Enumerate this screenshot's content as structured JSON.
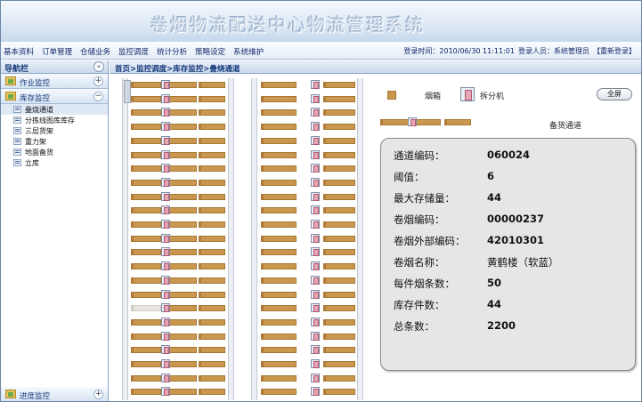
{
  "app": {
    "title": "卷烟物流配送中心物流管理系统"
  },
  "menu": [
    "基本资料",
    "订单管理",
    "仓储业务",
    "监控调度",
    "统计分析",
    "策略设定",
    "系统维护"
  ],
  "login": {
    "time_label": "登录时间：2010/06/30 11:11:01",
    "user_label": "登录人员：系统管理员",
    "relogin": "【重新登录】"
  },
  "sidebar": {
    "title": "导航栏",
    "collapse_glyph": "«",
    "groups": [
      {
        "label": "作业监控",
        "toggle": "+"
      },
      {
        "label": "库存监控",
        "toggle": "−"
      }
    ],
    "items": [
      "叠烧通道",
      "分拣线图库库存",
      "三层货架",
      "重力架",
      "地面备货",
      "立库"
    ],
    "bottom_group": {
      "label": "进度监控",
      "toggle": "+"
    }
  },
  "breadcrumb": "首页>监控调度>库存监控>叠烧通道",
  "legend": {
    "carton": "烟箱",
    "splitter": "拆分机",
    "channel": "备货通道"
  },
  "fullscreen_label": "全屏",
  "info": {
    "rows": [
      {
        "key": "通道编码：",
        "value": "060024"
      },
      {
        "key": "阈值：",
        "value": "6"
      },
      {
        "key": "最大存储量：",
        "value": "44"
      },
      {
        "key": "卷烟编码：",
        "value": "00000237"
      },
      {
        "key": "卷烟外部编码：",
        "value": "42010301"
      },
      {
        "key": "卷烟名称：",
        "value": "黄鹤楼（软蓝）"
      },
      {
        "key": "每件烟条数：",
        "value": "50"
      },
      {
        "key": "库存件数：",
        "value": "44"
      },
      {
        "key": "总条数：",
        "value": "2200"
      }
    ]
  },
  "colors": {
    "carton": "#c9974e",
    "empty": "#e8e6e1",
    "splitter": "#e5a5b4",
    "header": "#dfeaf6"
  }
}
